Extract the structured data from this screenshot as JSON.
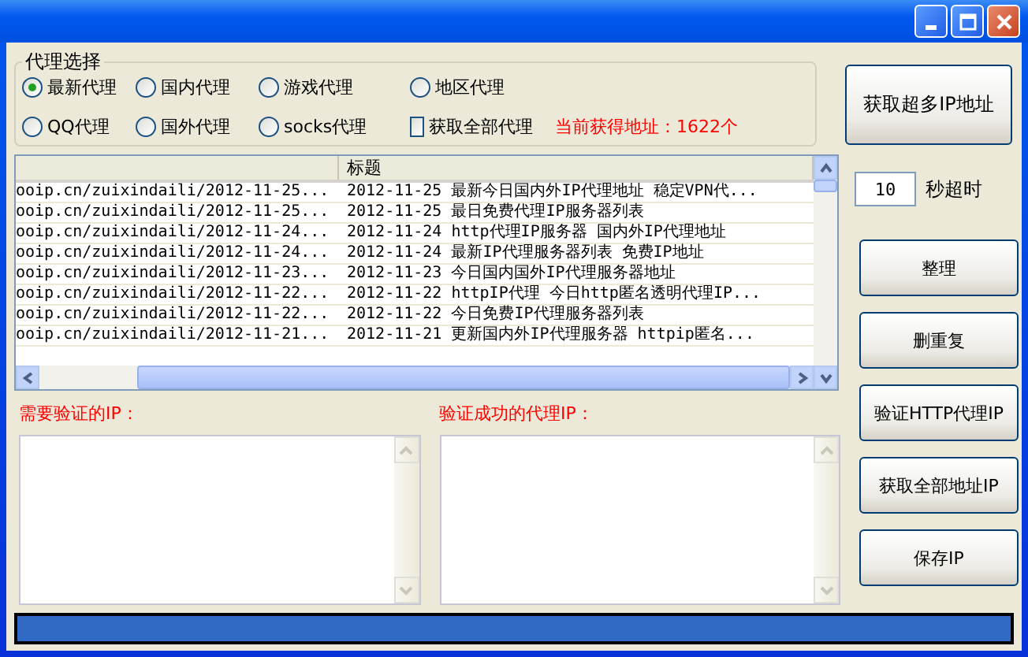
{
  "group": {
    "title": "代理选择"
  },
  "proxy_options": [
    {
      "label": "最新代理",
      "selected": true
    },
    {
      "label": "国内代理",
      "selected": false
    },
    {
      "label": "游戏代理",
      "selected": false
    },
    {
      "label": "地区代理",
      "selected": false
    },
    {
      "label": "QQ代理",
      "selected": false
    },
    {
      "label": "国外代理",
      "selected": false
    },
    {
      "label": "socks代理",
      "selected": false
    }
  ],
  "get_all": {
    "label": "获取全部代理",
    "checked": false
  },
  "count_text": "当前获得地址：1622个",
  "fetch_button": "获取超多IP地址",
  "table": {
    "columns": [
      "标题"
    ],
    "rows": [
      {
        "url": "ooip.cn/zuixindaili/2012-11-25...",
        "title": "2012-11-25 最新今日国内外IP代理地址 稳定VPN代..."
      },
      {
        "url": "ooip.cn/zuixindaili/2012-11-25...",
        "title": "2012-11-25 最日免费代理IP服务器列表"
      },
      {
        "url": "ooip.cn/zuixindaili/2012-11-24...",
        "title": "2012-11-24 http代理IP服务器 国内外IP代理地址"
      },
      {
        "url": "ooip.cn/zuixindaili/2012-11-24...",
        "title": "2012-11-24 最新IP代理服务器列表 免费IP地址"
      },
      {
        "url": "ooip.cn/zuixindaili/2012-11-23...",
        "title": "2012-11-23 今日国内国外IP代理服务器地址"
      },
      {
        "url": "ooip.cn/zuixindaili/2012-11-22...",
        "title": "2012-11-22 httpIP代理 今日http匿名透明代理IP..."
      },
      {
        "url": "ooip.cn/zuixindaili/2012-11-22...",
        "title": "2012-11-22 今日免费IP代理服务器列表"
      },
      {
        "url": "ooip.cn/zuixindaili/2012-11-21...",
        "title": "2012-11-21 更新国内外IP代理服务器 httpip匿名..."
      }
    ]
  },
  "timeout": {
    "value": "10",
    "label": "秒超时"
  },
  "actions": [
    "整理",
    "删重复",
    "验证HTTP代理IP",
    "获取全部地址IP",
    "保存IP"
  ],
  "pending_label": "需要验证的IP：",
  "success_label": "验证成功的代理IP：",
  "progress": {
    "level": 1
  }
}
